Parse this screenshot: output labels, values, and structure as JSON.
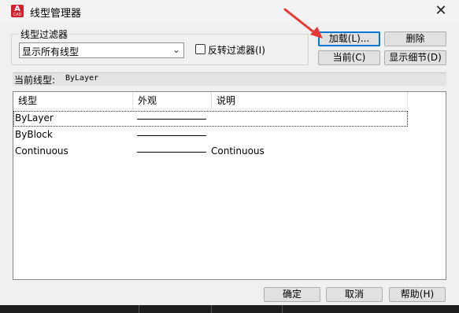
{
  "window": {
    "title": "线型管理器",
    "app_icon_letter": "A",
    "app_icon_sub": "CAD",
    "close_glyph": "✕"
  },
  "filter": {
    "group_label": "线型过滤器",
    "selected": "显示所有线型",
    "invert_label": "反转过滤器(I)",
    "invert_checked": false
  },
  "buttons": {
    "load": "加载(L)...",
    "delete": "删除",
    "current": "当前(C)",
    "details": "显示细节(D)",
    "ok": "确定",
    "cancel": "取消",
    "help": "帮助(H)"
  },
  "current_linetype": {
    "label": "当前线型:",
    "value": "ByLayer"
  },
  "table": {
    "columns": [
      "线型",
      "外观",
      "说明"
    ],
    "rows": [
      {
        "name": "ByLayer",
        "description": "",
        "selected": true
      },
      {
        "name": "ByBlock",
        "description": "",
        "selected": false
      },
      {
        "name": "Continuous",
        "description": "Continuous",
        "selected": false
      }
    ]
  },
  "colors": {
    "annotation_arrow": "#e53935",
    "default_button_border": "#0078d4",
    "app_icon": "#d21f2b"
  }
}
